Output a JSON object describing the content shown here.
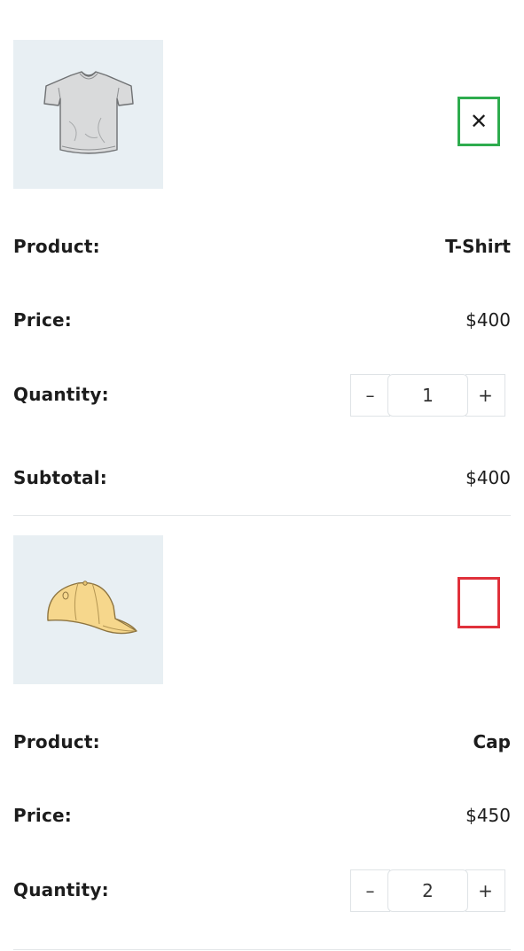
{
  "cart": {
    "items": [
      {
        "image_icon": "t-shirt-icon",
        "remove_icon": "close-icon",
        "remove_symbol": "✕",
        "remove_border_color": "#2eac4e",
        "product_label": "Product:",
        "product_value": "T-Shirt",
        "price_label": "Price:",
        "price_value": "$400",
        "quantity_label": "Quantity:",
        "quantity_value": "1",
        "minus_symbol": "–",
        "plus_symbol": "+",
        "subtotal_label": "Subtotal:",
        "subtotal_value": "$400"
      },
      {
        "image_icon": "cap-icon",
        "remove_border_color": "#e0313b",
        "product_label": "Product:",
        "product_value": "Cap",
        "price_label": "Price:",
        "price_value": "$450",
        "quantity_label": "Quantity:",
        "quantity_value": "2",
        "minus_symbol": "–",
        "plus_symbol": "+"
      }
    ]
  },
  "colors": {
    "thumb_background": "#e8eff3",
    "divider": "#e3e6e8",
    "text": "#1c1c1c"
  }
}
